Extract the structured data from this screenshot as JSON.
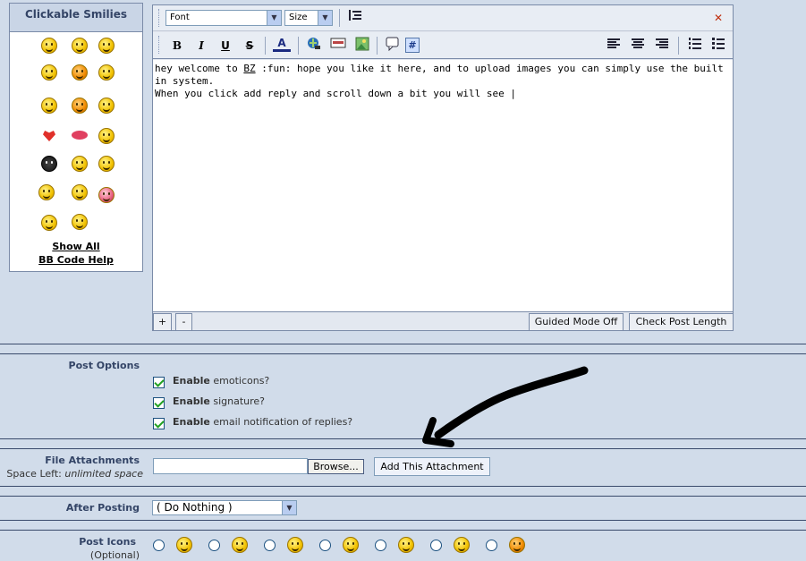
{
  "smilies": {
    "title": "Clickable Smilies",
    "show_all": "Show All",
    "bbcode_help": "BB Code Help"
  },
  "editor": {
    "font_select": "Font",
    "size_select": "Size",
    "text_line1": "hey welcome to ",
    "text_bz": "BZ",
    "text_line1_rest": " :fun: hope you like it here, and to upload images you can simply use the built in system.",
    "text_line2": "When you click add reply and scroll down a bit you will see |",
    "increase_label": "+",
    "decrease_label": "-",
    "guided_mode_label": "Guided Mode Off",
    "check_length_label": "Check Post Length",
    "toolbar": {
      "bold": "B",
      "italic": "I",
      "underline": "U",
      "strike": "S",
      "color": "A",
      "hash": "#"
    }
  },
  "post_options": {
    "label": "Post Options",
    "options": [
      {
        "strong": "Enable",
        "rest": " emoticons?"
      },
      {
        "strong": "Enable",
        "rest": " signature?"
      },
      {
        "strong": "Enable",
        "rest": " email notification of replies?"
      }
    ]
  },
  "attachments": {
    "label": "File Attachments",
    "space_left_label": "Space Left: ",
    "space_left_value": "unlimited space",
    "browse_label": "Browse...",
    "add_label": "Add This Attachment"
  },
  "after_posting": {
    "label": "After Posting",
    "selected": "( Do Nothing )"
  },
  "post_icons": {
    "label": "Post Icons",
    "optional": "(Optional)"
  }
}
